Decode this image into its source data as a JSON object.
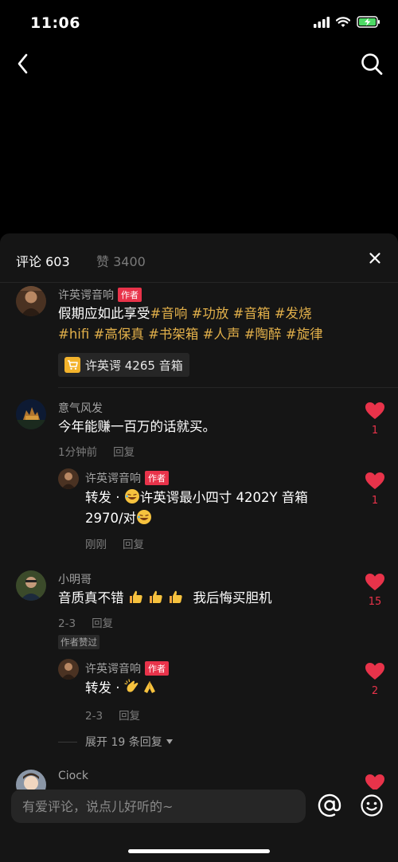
{
  "status": {
    "time": "11:06"
  },
  "tabs": {
    "comments": "评论 603",
    "likes": "赞 3400"
  },
  "comments": [
    {
      "user": "许英谔音响",
      "tag": "作者",
      "text": "假期应如此享受",
      "hashtags_line1": "#音响 #功放 #音箱 #发烧",
      "hashtags_line2": "#hifi #高保真 #书架箱 #人声 #陶醉 #旋律",
      "product": "许英谔 4265 音箱"
    },
    {
      "user": "意气风发",
      "text": "今年能赚一百万的话就买。",
      "time": "1分钟前",
      "reply": "回复",
      "likes": "1",
      "sub": {
        "user": "许英谔音响",
        "tag": "作者",
        "text_prefix": "转发 · ",
        "text_a": "许英谔最小四寸 4202Y 音箱",
        "text_b": "2970/对",
        "time": "刚刚",
        "reply": "回复",
        "likes": "1"
      }
    },
    {
      "user": "小明哥",
      "text_a": "音质真不错",
      "text_b": "我后悔买胆机",
      "time": "2-3",
      "reply": "回复",
      "likes": "15",
      "badge": "作者赞过",
      "sub": {
        "user": "许英谔音响",
        "tag": "作者",
        "text_prefix": "转发 · ",
        "time": "2-3",
        "reply": "回复",
        "likes": "2"
      },
      "expand": "展开 19 条回复"
    },
    {
      "user": "Ciock"
    }
  ],
  "input": {
    "placeholder": "有爱评论，说点儿好听的~"
  },
  "colors": {
    "accent": "#e8334a",
    "hashtag": "#e2b04a",
    "sheet": "#151515"
  }
}
